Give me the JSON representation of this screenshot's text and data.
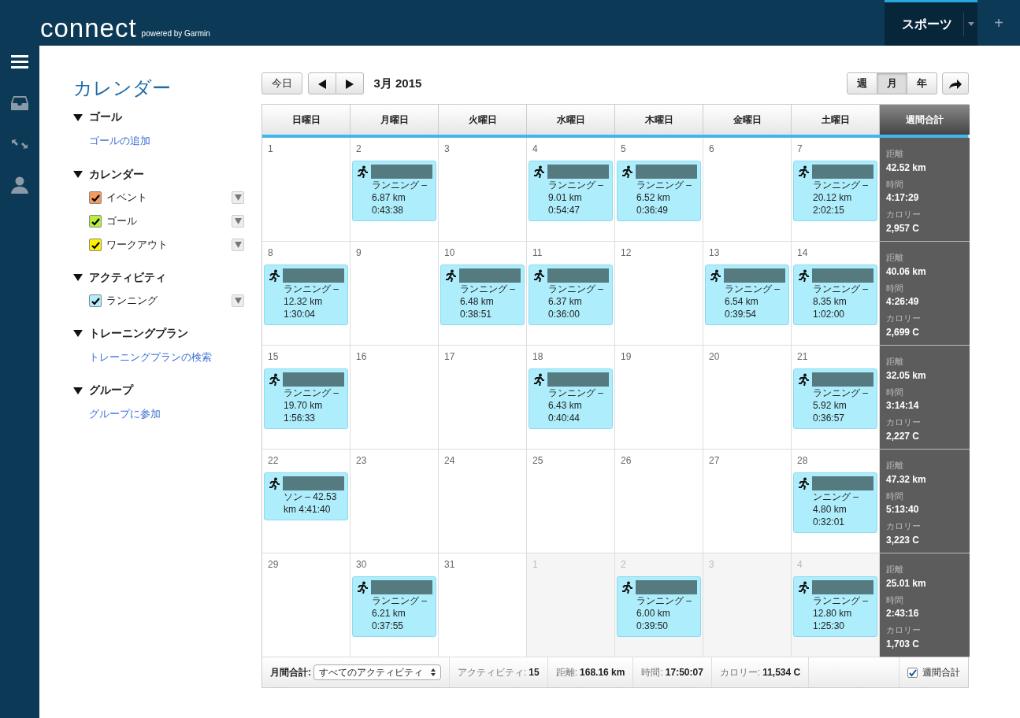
{
  "header": {
    "logo": "connect",
    "powered_by": "powered by Garmin",
    "tabs": [
      {
        "label": "スポーツ",
        "selected": true
      }
    ],
    "add_tab": "+"
  },
  "rail": {
    "items": [
      {
        "kind": "menu"
      },
      {
        "kind": "inbox"
      },
      {
        "kind": "arrows"
      },
      {
        "kind": "person"
      }
    ]
  },
  "sidebar": {
    "title": "カレンダー",
    "sections": [
      {
        "title": "ゴール",
        "expanded": true,
        "links": [
          "ゴールの追加"
        ]
      },
      {
        "title": "カレンダー",
        "expanded": true,
        "items": [
          {
            "label": "イベント",
            "checked": true,
            "color": "#f59a5e"
          },
          {
            "label": "ゴール",
            "checked": true,
            "color": "#b6f03c"
          },
          {
            "label": "ワークアウト",
            "checked": true,
            "color": "#fff200"
          }
        ]
      },
      {
        "title": "アクティビティ",
        "expanded": true,
        "items": [
          {
            "label": "ランニング",
            "checked": true,
            "color": "#b3ecfb"
          }
        ]
      },
      {
        "title": "トレーニングプラン",
        "expanded": true,
        "links": [
          "トレーニングプランの検索"
        ]
      },
      {
        "title": "グループ",
        "expanded": true,
        "links": [
          "グループに参加"
        ]
      }
    ]
  },
  "toolbar": {
    "today": "今日",
    "period": "3月 2015",
    "views": [
      {
        "label": "週",
        "selected": false
      },
      {
        "label": "月",
        "selected": true
      },
      {
        "label": "年",
        "selected": false
      }
    ]
  },
  "calendar": {
    "columns": [
      "日曜日",
      "月曜日",
      "火曜日",
      "水曜日",
      "木曜日",
      "金曜日",
      "土曜日"
    ],
    "totals_column": "週間合計",
    "weeks": [
      {
        "days": [
          {
            "day": "1",
            "outside_month": false
          },
          {
            "day": "2",
            "outside_month": false,
            "event": "ランニング – 6.87 km 0:43:38"
          },
          {
            "day": "3",
            "outside_month": false
          },
          {
            "day": "4",
            "outside_month": false,
            "event": "ランニング – 9.01 km 0:54:47"
          },
          {
            "day": "5",
            "outside_month": false,
            "event": "ランニング – 6.52 km 0:36:49"
          },
          {
            "day": "6",
            "outside_month": false
          },
          {
            "day": "7",
            "outside_month": false,
            "event": "ランニング – 20.12 km 2:02:15"
          }
        ],
        "totals": [
          {
            "label": "距離",
            "value": "42.52 km"
          },
          {
            "label": "時間",
            "value": "4:17:29"
          },
          {
            "label": "カロリー",
            "value": "2,957 C"
          }
        ]
      },
      {
        "days": [
          {
            "day": "8",
            "outside_month": false,
            "event": "ランニング – 12.32 km 1:30:04"
          },
          {
            "day": "9",
            "outside_month": false
          },
          {
            "day": "10",
            "outside_month": false,
            "event": "ランニング – 6.48 km 0:38:51"
          },
          {
            "day": "11",
            "outside_month": false,
            "event": "ランニング – 6.37 km 0:36:00"
          },
          {
            "day": "12",
            "outside_month": false
          },
          {
            "day": "13",
            "outside_month": false,
            "event": "ランニング – 6.54 km 0:39:54"
          },
          {
            "day": "14",
            "outside_month": false,
            "event": "ランニング – 8.35 km 1:02:00"
          }
        ],
        "totals": [
          {
            "label": "距離",
            "value": "40.06 km"
          },
          {
            "label": "時間",
            "value": "4:26:49"
          },
          {
            "label": "カロリー",
            "value": "2,699 C"
          }
        ]
      },
      {
        "days": [
          {
            "day": "15",
            "outside_month": false,
            "event": "ランニング – 19.70 km 1:56:33"
          },
          {
            "day": "16",
            "outside_month": false
          },
          {
            "day": "17",
            "outside_month": false
          },
          {
            "day": "18",
            "outside_month": false,
            "event": "ランニング – 6.43 km 0:40:44"
          },
          {
            "day": "19",
            "outside_month": false
          },
          {
            "day": "20",
            "outside_month": false
          },
          {
            "day": "21",
            "outside_month": false,
            "event": "ランニング – 5.92 km 0:36:57"
          }
        ],
        "totals": [
          {
            "label": "距離",
            "value": "32.05 km"
          },
          {
            "label": "時間",
            "value": "3:14:14"
          },
          {
            "label": "カロリー",
            "value": "2,227 C"
          }
        ]
      },
      {
        "days": [
          {
            "day": "22",
            "outside_month": false,
            "event": "ソン – 42.53 km 4:41:40"
          },
          {
            "day": "23",
            "outside_month": false
          },
          {
            "day": "24",
            "outside_month": false
          },
          {
            "day": "25",
            "outside_month": false
          },
          {
            "day": "26",
            "outside_month": false
          },
          {
            "day": "27",
            "outside_month": false
          },
          {
            "day": "28",
            "outside_month": false,
            "event": "ンニング – 4.80 km 0:32:01"
          }
        ],
        "totals": [
          {
            "label": "距離",
            "value": "47.32 km"
          },
          {
            "label": "時間",
            "value": "5:13:40"
          },
          {
            "label": "カロリー",
            "value": "3,223 C"
          }
        ]
      },
      {
        "days": [
          {
            "day": "29",
            "outside_month": false
          },
          {
            "day": "30",
            "outside_month": false,
            "event": "ランニング – 6.21 km 0:37:55"
          },
          {
            "day": "31",
            "outside_month": false
          },
          {
            "day": "1",
            "outside_month": true
          },
          {
            "day": "2",
            "outside_month": true,
            "event": "ランニング – 6.00 km 0:39:50"
          },
          {
            "day": "3",
            "outside_month": true
          },
          {
            "day": "4",
            "outside_month": true,
            "event": "ランニング – 12.80 km 1:25:30"
          }
        ],
        "totals": [
          {
            "label": "距離",
            "value": "25.01 km"
          },
          {
            "label": "時間",
            "value": "2:43:16"
          },
          {
            "label": "カロリー",
            "value": "1,703 C"
          }
        ]
      }
    ]
  },
  "footer": {
    "label": "月間合計:",
    "filter": "すべてのアクティビティ",
    "stats": [
      {
        "label": "アクティビティ:",
        "value": "15"
      },
      {
        "label": "距離:",
        "value": "168.16 km"
      },
      {
        "label": "時間:",
        "value": "17:50:07"
      },
      {
        "label": "カロリー:",
        "value": "11,534 C"
      }
    ],
    "weekly_totals": {
      "label": "週間合計",
      "checked": true
    }
  }
}
